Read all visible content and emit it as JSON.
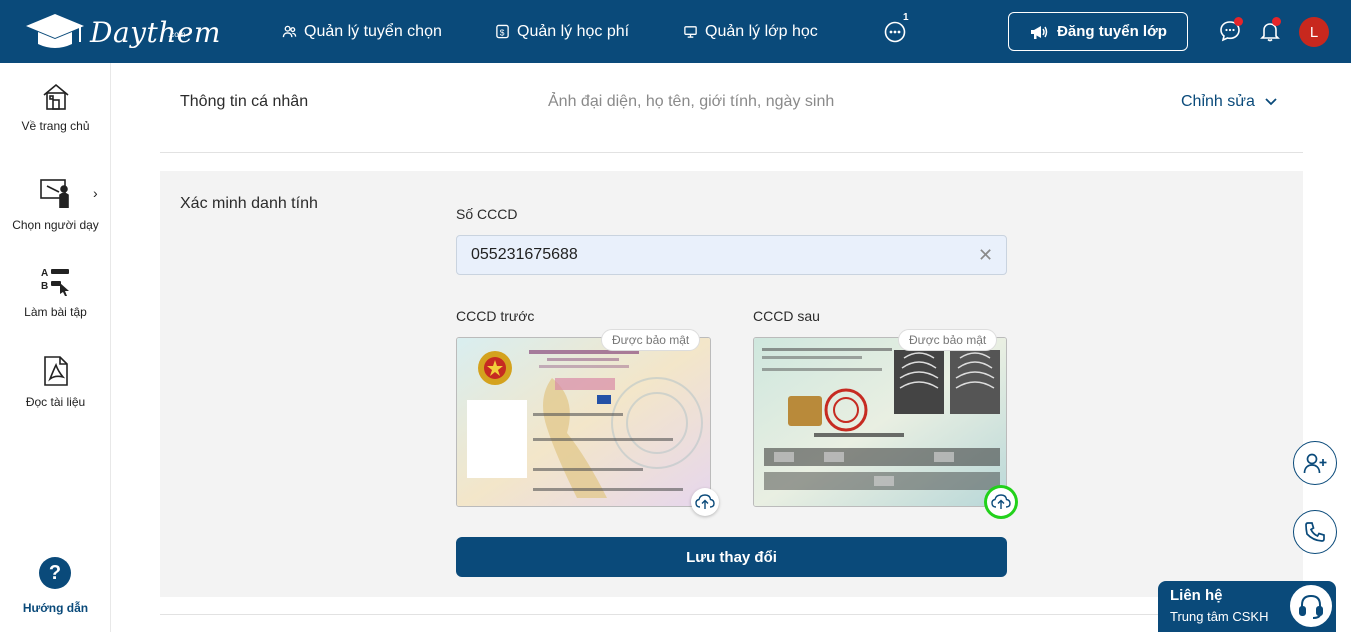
{
  "brand": {
    "name": "Daythem",
    "suffix": ".com"
  },
  "nav": {
    "recruit": "Quản lý tuyển chọn",
    "fees": "Quản lý học phí",
    "classes": "Quản lý lớp học",
    "more_badge": "1"
  },
  "header": {
    "post_button": "Đăng tuyển lớp",
    "avatar_letter": "L"
  },
  "sidebar": {
    "home": "Về trang chủ",
    "choose_tutor": "Chọn người dạy",
    "exercises": "Làm bài tập",
    "documents": "Đọc tài liệu",
    "help": "Hướng dẫn"
  },
  "personal": {
    "title": "Thông tin cá nhân",
    "subtitle": "Ảnh đại diện, họ tên, giới tính, ngày sinh",
    "edit": "Chỉnh sửa"
  },
  "identity": {
    "title": "Xác minh danh tính",
    "cccd_label": "Số CCCD",
    "cccd_value": "055231675688",
    "front_label": "CCCD trước",
    "back_label": "CCCD sau",
    "secure_tag": "Được bảo mật",
    "save_button": "Lưu thay đổi"
  },
  "contact": {
    "title": "Liên hệ",
    "subtitle": "Trung tâm CSKH"
  },
  "colors": {
    "primary": "#0a4a7a",
    "notification": "#e5252a",
    "avatar": "#c8281e",
    "highlight": "#22d11b"
  }
}
